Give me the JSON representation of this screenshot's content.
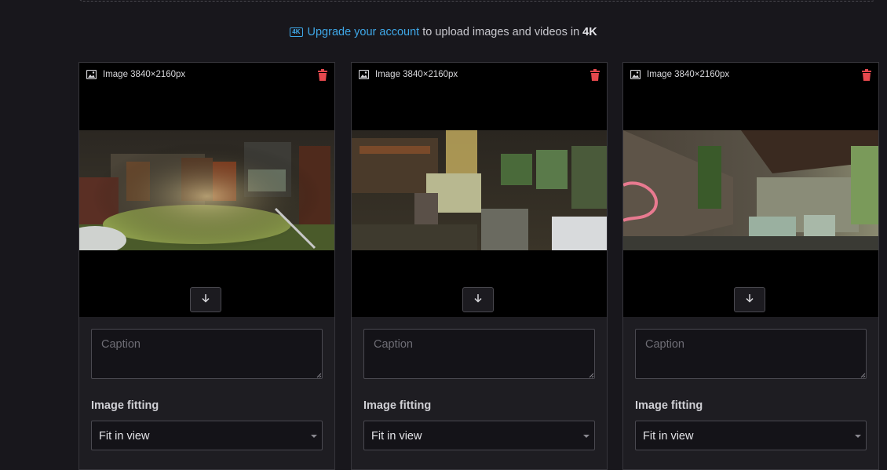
{
  "upgrade_notice": {
    "badge": "4K",
    "link": "Upgrade your account",
    "text": "to upload images and videos in",
    "emphasis": "4K"
  },
  "colors": {
    "accent": "#3fa8e8",
    "danger": "#e5484d"
  },
  "cards": [
    {
      "info": "Image 3840×2160px",
      "caption_placeholder": "Caption",
      "caption_value": "",
      "fitting_label": "Image fitting",
      "fitting_value": "Fit in view",
      "icons": {
        "image": "image-icon",
        "delete": "trash-icon",
        "download": "arrow-down-icon"
      }
    },
    {
      "info": "Image 3840×2160px",
      "caption_placeholder": "Caption",
      "caption_value": "",
      "fitting_label": "Image fitting",
      "fitting_value": "Fit in view",
      "icons": {
        "image": "image-icon",
        "delete": "trash-icon",
        "download": "arrow-down-icon"
      }
    },
    {
      "info": "Image 3840×2160px",
      "caption_placeholder": "Caption",
      "caption_value": "",
      "fitting_label": "Image fitting",
      "fitting_value": "Fit in view",
      "icons": {
        "image": "image-icon",
        "delete": "trash-icon",
        "download": "arrow-down-icon"
      }
    }
  ]
}
